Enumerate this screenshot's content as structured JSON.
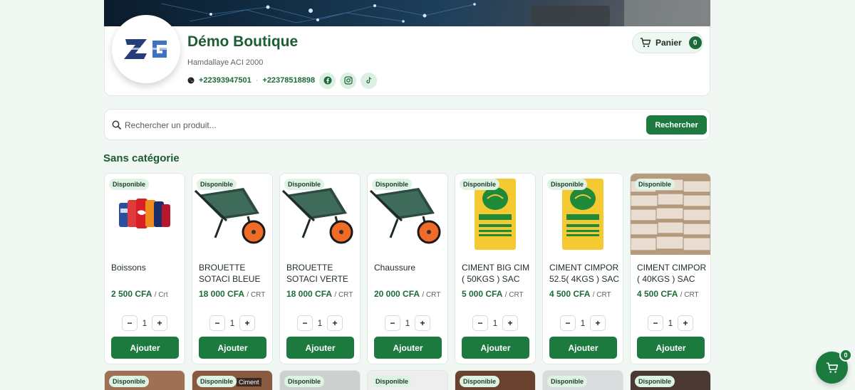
{
  "store": {
    "name": "Démo Boutique",
    "address": "Hamdallaye ACI 2000",
    "phone1": "+22393947501",
    "separator": "·",
    "phone2": "+22378518898",
    "logo_text": "ZG",
    "social_icons": [
      "facebook-icon",
      "instagram-icon",
      "tiktok-icon"
    ]
  },
  "cart": {
    "label": "Panier",
    "count": "0"
  },
  "search": {
    "placeholder": "Rechercher un produit...",
    "button": "Rechercher"
  },
  "section": {
    "title": "Sans catégorie"
  },
  "colors": {
    "brand": "#1c7a3e",
    "brand_dark": "#1c5e34",
    "badge_bg": "#dff3e5",
    "background": "#f1f8f3"
  },
  "products": [
    {
      "badge": "Disponible",
      "name": "Boissons",
      "price": "2 500 CFA",
      "unit": "/ Crt",
      "qty": "1",
      "button": "Ajouter",
      "image": "soda-cans"
    },
    {
      "badge": "Disponible",
      "name": "BROUETTE SOTACI BLEUE",
      "price": "18 000 CFA",
      "unit": "/ CRT",
      "qty": "1",
      "button": "Ajouter",
      "image": "wheelbarrow"
    },
    {
      "badge": "Disponible",
      "name": "BROUETTE SOTACI VERTE",
      "price": "18 000 CFA",
      "unit": "/ CRT",
      "qty": "1",
      "button": "Ajouter",
      "image": "wheelbarrow"
    },
    {
      "badge": "Disponible",
      "name": "Chaussure",
      "price": "20 000 CFA",
      "unit": "/ CRT",
      "qty": "1",
      "button": "Ajouter",
      "image": "wheelbarrow"
    },
    {
      "badge": "Disponible",
      "name": "CIMENT BIG CIM ( 50KGS ) SAC",
      "price": "5 000 CFA",
      "unit": "/ CRT",
      "qty": "1",
      "button": "Ajouter",
      "image": "cement-bag"
    },
    {
      "badge": "Disponible",
      "name": "CIMENT CIMPOR 52.5( 4KGS ) SAC",
      "price": "4 500 CFA",
      "unit": "/ CRT",
      "qty": "1",
      "button": "Ajouter",
      "image": "cement-bag"
    },
    {
      "badge": "Disponible",
      "name": "CIMENT CIMPOR ( 40KGS ) SAC",
      "price": "4 500 CFA",
      "unit": "/ CRT",
      "qty": "1",
      "button": "Ajouter",
      "image": "cement-stack"
    }
  ],
  "products_row2": [
    {
      "badge": "Disponible"
    },
    {
      "badge": "Disponible",
      "label": "Ciment"
    },
    {
      "badge": "Disponible"
    },
    {
      "badge": "Disponible"
    },
    {
      "badge": "Disponible"
    },
    {
      "badge": "Disponible"
    },
    {
      "badge": "Disponible"
    }
  ],
  "floating_cart": {
    "count": "0"
  }
}
